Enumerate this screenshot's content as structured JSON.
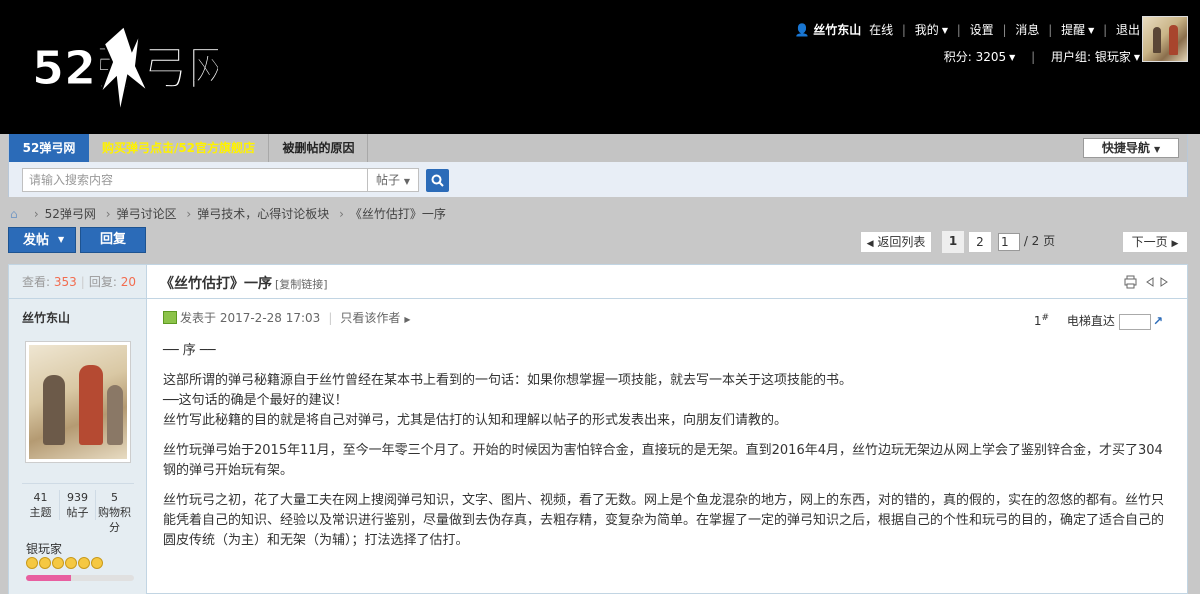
{
  "header": {
    "logo_text": "52弹弓网",
    "user": {
      "name": "丝竹东山",
      "status": "在线"
    },
    "user_menu": [
      "我的",
      "设置",
      "消息",
      "提醒",
      "退出"
    ],
    "credits_label": "积分: 3205",
    "group_label": "用户组: 银玩家"
  },
  "nav": {
    "items": [
      "52弹弓网",
      "购买弹弓点击/52官方旗舰店",
      "被删帖的原因"
    ],
    "quick_nav": "快捷导航",
    "search_placeholder": "请输入搜索内容",
    "search_type": "帖子"
  },
  "breadcrumb": [
    "52弹弓网",
    "弹弓讨论区",
    "弹弓技术，心得讨论板块",
    "《丝竹估打》一序"
  ],
  "actions": {
    "post": "发帖",
    "reply": "回复"
  },
  "pager": {
    "back": "返回列表",
    "current": "1",
    "page2": "2",
    "input_value": "1",
    "total": "/ 2 页",
    "next": "下一页"
  },
  "thread": {
    "views_label": "查看:",
    "views": "353",
    "replies_label": "回复:",
    "replies": "20",
    "title": "《丝竹估打》一序",
    "copy_link": "[复制链接]",
    "author": "丝竹东山",
    "author_stats": [
      {
        "value": "41",
        "label": "主题"
      },
      {
        "value": "939",
        "label": "帖子"
      },
      {
        "value": "5",
        "label": "购物积分"
      }
    ],
    "author_group": "银玩家",
    "level_progress": 0.42,
    "post_time": "发表于 2017-2-28 17:03",
    "only_author": "只看该作者",
    "floor": "1",
    "floor_sup": "#",
    "elevator": "电梯直达",
    "content": [
      "── 序 ──",
      "",
      "这部所谓的弹弓秘籍源自于丝竹曾经在某本书上看到的一句话：如果你想掌握一项技能，就去写一本关于这项技能的书。",
      "──这句话的确是个最好的建议！",
      "丝竹写此秘籍的目的就是将自己对弹弓，尤其是估打的认知和理解以帖子的形式发表出来，向朋友们请教的。",
      "",
      "丝竹玩弹弓始于2015年11月，至今一年零三个月了。开始的时候因为害怕锌合金，直接玩的是无架。直到2016年4月，丝竹边玩无架边从网上学会了鉴别锌合金，才买了304钢的弹弓开始玩有架。",
      "",
      "丝竹玩弓之初，花了大量工夫在网上搜阅弹弓知识，文字、图片、视频，看了无数。网上是个鱼龙混杂的地方，网上的东西，对的错的，真的假的，实在的忽悠的都有。丝竹只能凭着自己的知识、经验以及常识进行鉴别，尽量做到去伪存真，去粗存精，变复杂为简单。在掌握了一定的弹弓知识之后，根据自己的个性和玩弓的目的，确定了适合自己的圆皮传统（为主）和无架（为辅）；打法选择了估打。"
    ]
  }
}
